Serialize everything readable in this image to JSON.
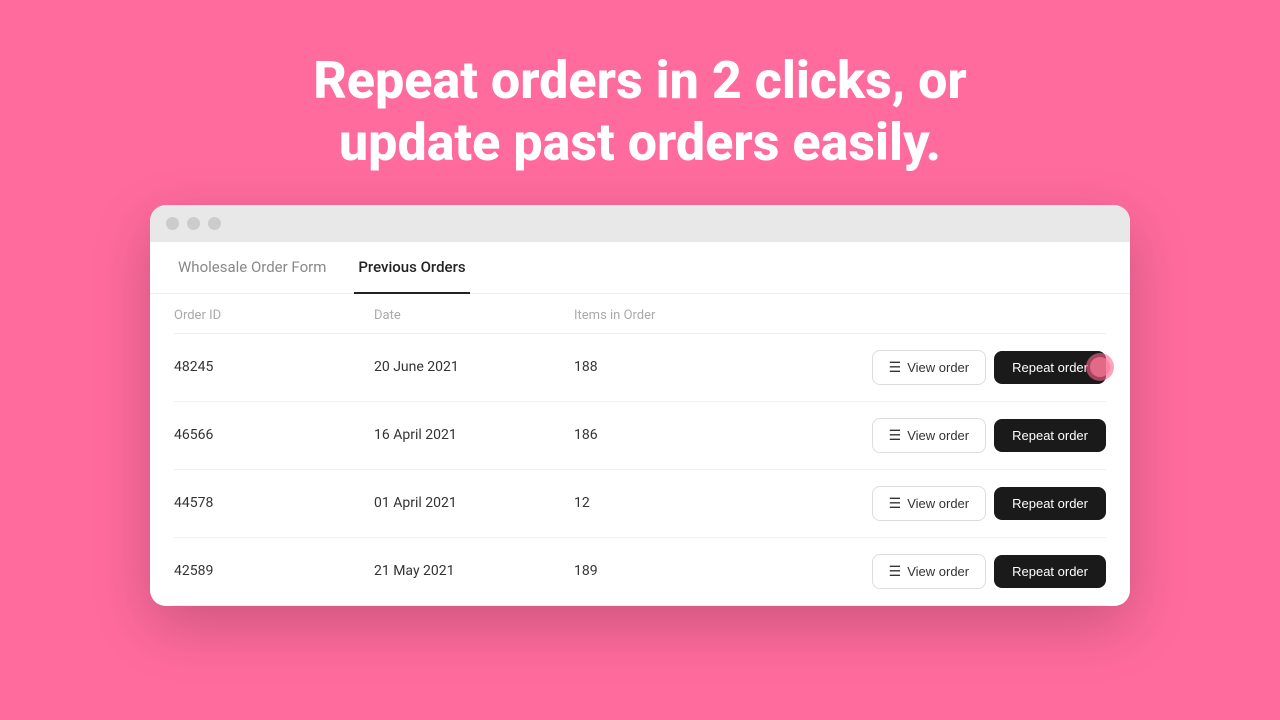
{
  "background_color": "#FF6B9D",
  "hero": {
    "line1": "Repeat orders in 2 clicks, or",
    "line2": "update past orders easily."
  },
  "browser": {
    "dots": [
      "dot1",
      "dot2",
      "dot3"
    ]
  },
  "tabs": [
    {
      "label": "Wholesale Order Form",
      "active": false
    },
    {
      "label": "Previous Orders",
      "active": true
    }
  ],
  "table": {
    "headers": [
      "Order ID",
      "Date",
      "Items in Order",
      ""
    ],
    "rows": [
      {
        "id": "48245",
        "date": "20 June 2021",
        "items": "188",
        "highlighted": true
      },
      {
        "id": "46566",
        "date": "16 April 2021",
        "items": "186",
        "highlighted": false
      },
      {
        "id": "44578",
        "date": "01 April 2021",
        "items": "12",
        "highlighted": false
      },
      {
        "id": "42589",
        "date": "21 May 2021",
        "items": "189",
        "highlighted": false
      }
    ],
    "view_label": "View order",
    "repeat_label": "Repeat order"
  }
}
